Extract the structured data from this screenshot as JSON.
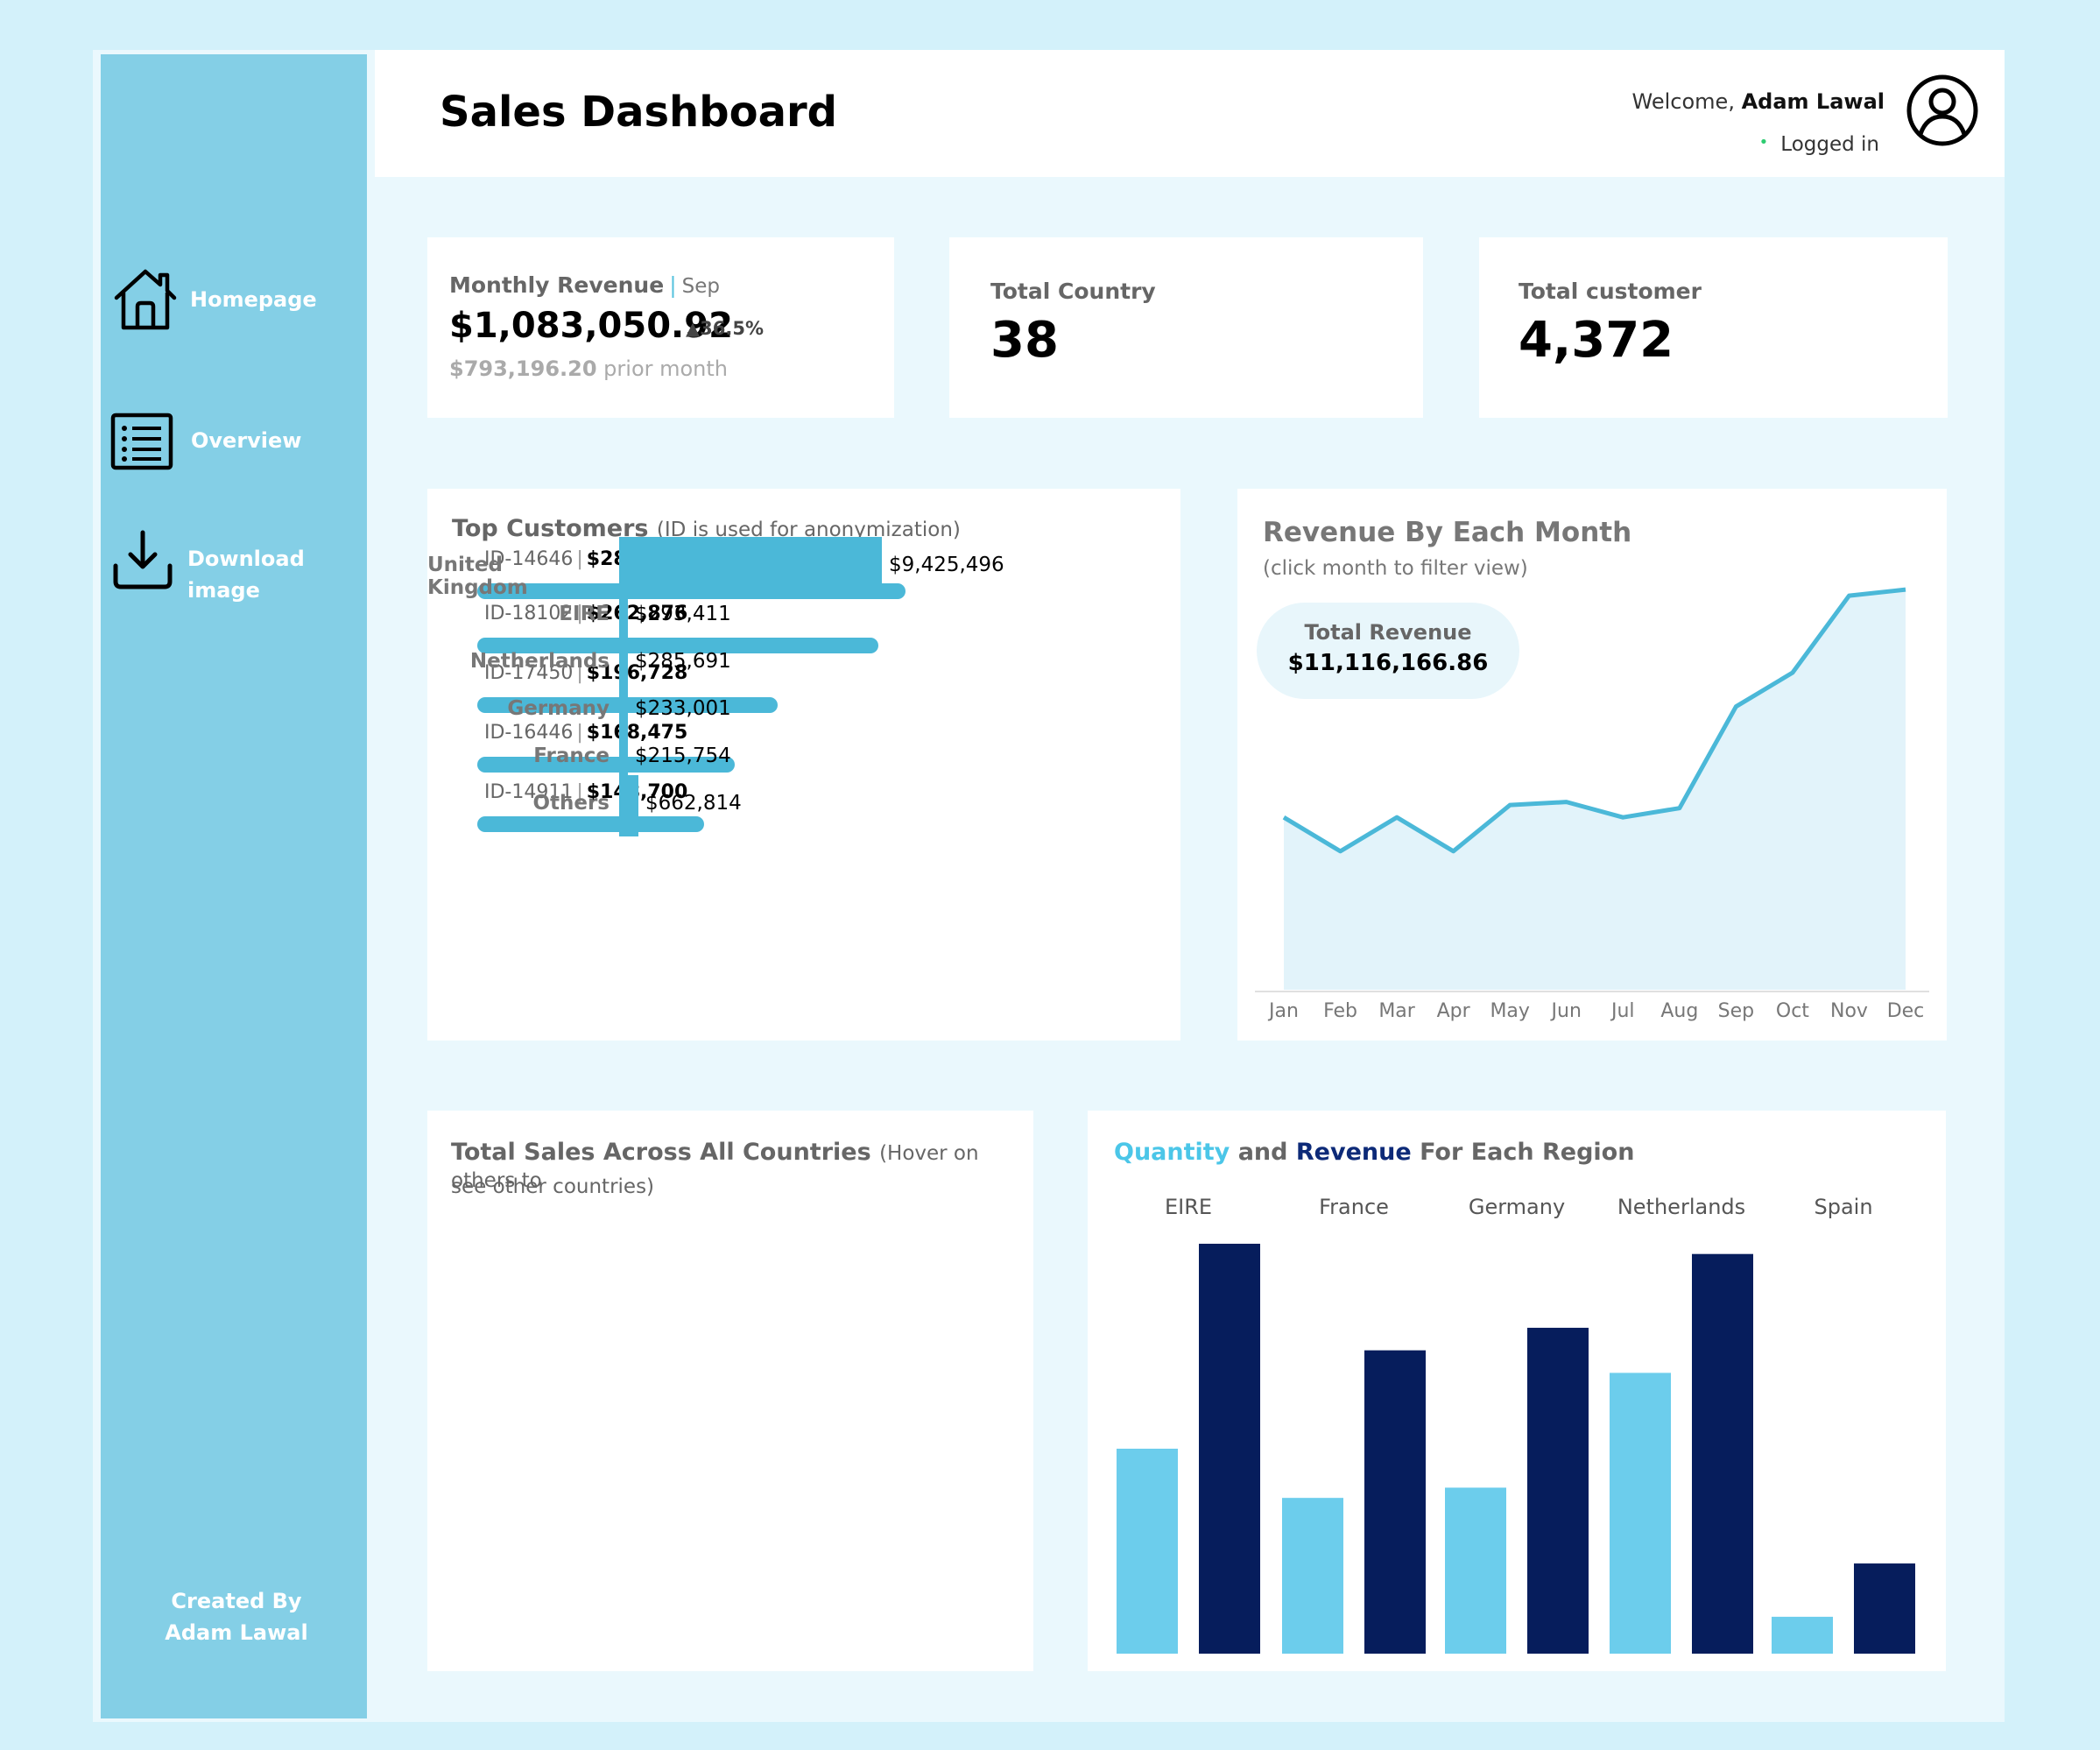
{
  "header": {
    "title": "Sales Dashboard",
    "welcome_prefix": "Welcome,",
    "user_name": "Adam Lawal",
    "status": "Logged in"
  },
  "sidebar": {
    "items": [
      {
        "label": "Homepage",
        "icon": "home-icon"
      },
      {
        "label": "Overview",
        "icon": "list-icon"
      },
      {
        "label": "Download image",
        "icon": "download-icon"
      }
    ],
    "credit_line1": "Created By",
    "credit_line2": "Adam Lawal"
  },
  "kpis": {
    "monthly_revenue": {
      "label": "Monthly Revenue",
      "month": "Sep",
      "value": "$1,083,050.92",
      "change": "▲36.5%",
      "prior_value": "$793,196.20",
      "prior_label": "prior month"
    },
    "total_country": {
      "label": "Total Country",
      "value": "38"
    },
    "total_customer": {
      "label": "Total customer",
      "value": "4,372"
    }
  },
  "top_customers": {
    "title": "Top Customers",
    "subtitle": "(ID is used for anonymization)",
    "rows": [
      {
        "id": "ID-14646",
        "amount": "$280,430",
        "value": 280430
      },
      {
        "id": "ID-18102",
        "amount": "$262,876",
        "value": 262876
      },
      {
        "id": "ID-17450",
        "amount": "$196,728",
        "value": 196728
      },
      {
        "id": "ID-16446",
        "amount": "$168,475",
        "value": 168475
      },
      {
        "id": "ID-14911",
        "amount": "$148,700",
        "value": 148700
      }
    ]
  },
  "revenue_by_month": {
    "title": "Revenue By Each Month",
    "subtitle": "(click month to filter view)",
    "total_label": "Total Revenue",
    "total_value": "$11,116,166.86"
  },
  "countries": {
    "title": "Total Sales Across All Countries",
    "subtitle_part1": "(Hover on others to",
    "subtitle_part2": "see other countries)",
    "rows": [
      {
        "country": "United Kingdom",
        "amount": "$9,425,496",
        "value": 9425496
      },
      {
        "country": "EIRE",
        "amount": "$293,411",
        "value": 293411
      },
      {
        "country": "Netherlands",
        "amount": "$285,691",
        "value": 285691
      },
      {
        "country": "Germany",
        "amount": "$233,001",
        "value": 233001
      },
      {
        "country": "France",
        "amount": "$215,754",
        "value": 215754
      },
      {
        "country": "Others",
        "amount": "$662,814",
        "value": 662814
      }
    ]
  },
  "region": {
    "title_quantity": "Quantity",
    "title_and": "and",
    "title_revenue": "Revenue",
    "title_rest": "For Each Region"
  },
  "colors": {
    "sidebar": "#84cfe6",
    "accent": "#4bb8d8",
    "quantity_bar": "#6ccdec",
    "revenue_bar": "#061d5c",
    "line": "#4bb8d8",
    "area": "#e2f3fa"
  },
  "chart_data": [
    {
      "type": "area",
      "title": "Revenue By Each Month",
      "categories": [
        "Jan",
        "Feb",
        "Mar",
        "Apr",
        "May",
        "Jun",
        "Jul",
        "Aug",
        "Sep",
        "Oct",
        "Nov",
        "Dec"
      ],
      "series": [
        {
          "values": [
            560000,
            450000,
            560000,
            450000,
            600000,
            610000,
            560000,
            590000,
            920000,
            1030000,
            1280000,
            1300000
          ]
        }
      ],
      "ylim": [
        0,
        1400000
      ],
      "grid": false
    },
    {
      "type": "bar",
      "title": "Total Sales Across All Countries",
      "categories": [
        "United Kingdom",
        "EIRE",
        "Netherlands",
        "Germany",
        "France",
        "Others"
      ],
      "values": [
        9425496,
        293411,
        285691,
        233001,
        215754,
        662814
      ],
      "orientation": "horizontal"
    },
    {
      "type": "bar",
      "title": "Quantity and Revenue For Each Region",
      "categories": [
        "EIRE",
        "France",
        "Germany",
        "Netherlands",
        "Spain"
      ],
      "series": [
        {
          "name": "Quantity",
          "values": [
            0.5,
            0.38,
            0.405,
            0.685,
            0.09
          ]
        },
        {
          "name": "Revenue",
          "values": [
            1.0,
            0.74,
            0.795,
            0.975,
            0.22
          ]
        }
      ],
      "ylim": [
        0,
        1
      ],
      "grid": false
    }
  ]
}
